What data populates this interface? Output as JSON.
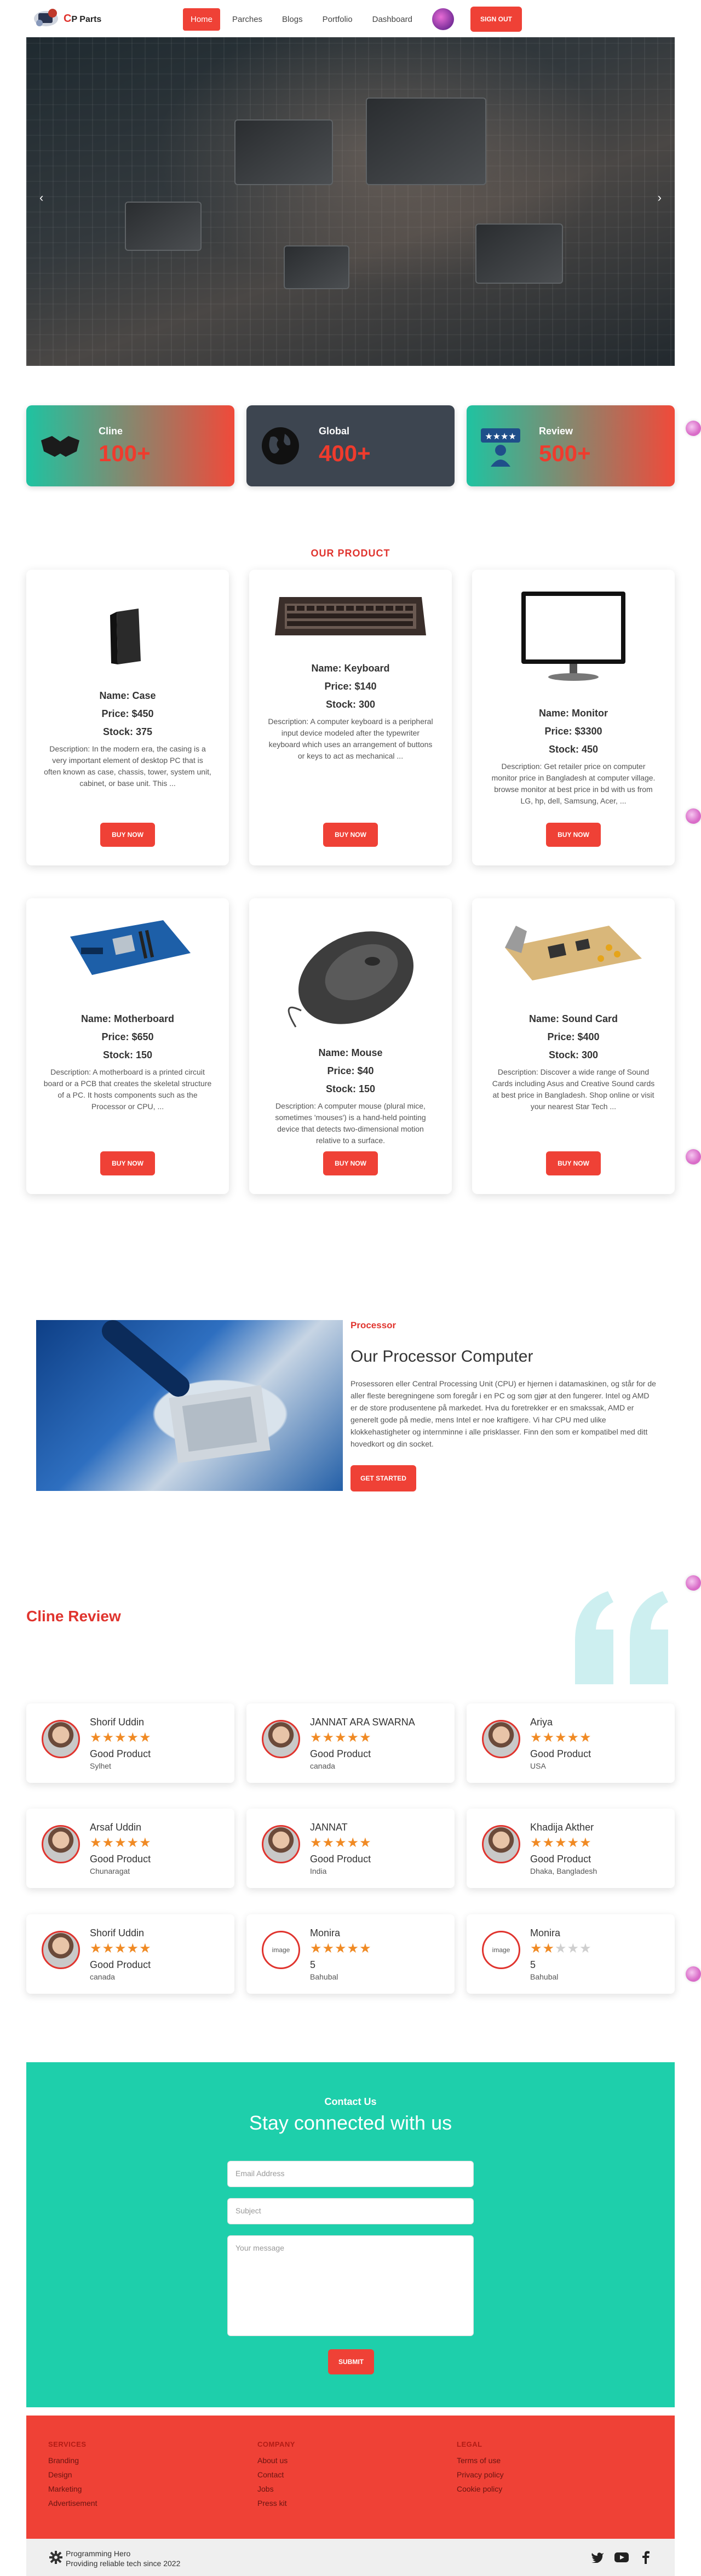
{
  "brand": {
    "initial": "C",
    "name": "P Parts"
  },
  "nav": {
    "items": [
      {
        "label": "Home",
        "active": true
      },
      {
        "label": "Parches",
        "active": false
      },
      {
        "label": "Blogs",
        "active": false
      },
      {
        "label": "Portfolio",
        "active": false
      },
      {
        "label": "Dashboard",
        "active": false
      }
    ],
    "signout_label": "SIGN OUT"
  },
  "hero": {
    "prev_icon": "chevron-left-icon",
    "next_icon": "chevron-right-icon"
  },
  "stats": [
    {
      "label": "Cline",
      "value": "100+",
      "icon": "handshake-icon"
    },
    {
      "label": "Global",
      "value": "400+",
      "icon": "globe-icon"
    },
    {
      "label": "Review",
      "value": "500+",
      "icon": "review-icon"
    }
  ],
  "products": {
    "section_title": "OUR PRODUCT",
    "items": [
      {
        "name": "Name: Case",
        "price": "Price: $450",
        "stock": "Stock: 375",
        "description": "Description: In the modern era, the casing is a very important element of desktop PC that is often known as case, chassis, tower, system unit, cabinet, or base unit. This ...",
        "button": "BUY NOW",
        "image": "pc-case"
      },
      {
        "name": "Name: Keyboard",
        "price": "Price: $140",
        "stock": "Stock: 300",
        "description": "Description: A computer keyboard is a peripheral input device modeled after the typewriter keyboard which uses an arrangement of buttons or keys to act as mechanical ...",
        "button": "BUY NOW",
        "image": "keyboard"
      },
      {
        "name": "Name: Monitor",
        "price": "Price: $3300",
        "stock": "Stock: 450",
        "description": "Description: Get retailer price on computer monitor price in Bangladesh at computer village. browse monitor at best price in bd with us from LG, hp, dell, Samsung, Acer, ...",
        "button": "BUY NOW",
        "image": "monitor"
      },
      {
        "name": "Name: Motherboard",
        "price": "Price: $650",
        "stock": "Stock: 150",
        "description": "Description: A motherboard is a printed circuit board or a PCB that creates the skeletal structure of a PC. It hosts components such as the Processor or CPU, ...",
        "button": "BUY NOW",
        "image": "motherboard"
      },
      {
        "name": "Name: Mouse",
        "price": "Price: $40",
        "stock": "Stock: 150",
        "description": "Description: A computer mouse (plural mice, sometimes 'mouses') is a hand-held pointing device that detects two-dimensional motion relative to a surface.",
        "button": "BUY NOW",
        "image": "mouse"
      },
      {
        "name": "Name: Sound Card",
        "price": "Price: $400",
        "stock": "Stock: 300",
        "description": "Description: Discover a wide range of Sound Cards including Asus and Creative Sound cards at best price in Bangladesh. Shop online or visit your nearest Star Tech ...",
        "button": "BUY NOW",
        "image": "sound-card"
      }
    ]
  },
  "processor": {
    "kicker": "Processor",
    "title": "Our Processor Computer",
    "description": "Prosessoren eller Central Processing Unit (CPU) er hjernen i datamaskinen, og står for de aller fleste beregningene som foregår i en PC og som gjør at den fungerer. Intel og AMD er de store produsentene på markedet. Hva du foretrekker er en smakssak, AMD er generelt gode på medie, mens Intel er noe kraftigere. Vi har CPU med ulike klokkehastigheter og internminne i alle prisklasser. Finn den som er kompatibel med ditt hovedkort og din socket.",
    "button": "GET STARTED"
  },
  "reviews": {
    "title": "Cline Review",
    "items": [
      {
        "name": "Shorif Uddin",
        "rating": 5,
        "text": "Good Product",
        "location": "Sylhet",
        "avatar": ""
      },
      {
        "name": "JANNAT ARA SWARNA",
        "rating": 5,
        "text": "Good Product",
        "location": "canada",
        "avatar": ""
      },
      {
        "name": "Ariya",
        "rating": 5,
        "text": "Good Product",
        "location": "USA",
        "avatar": ""
      },
      {
        "name": "Arsaf Uddin",
        "rating": 5,
        "text": "Good Product",
        "location": "Chunaragat",
        "avatar": ""
      },
      {
        "name": "JANNAT",
        "rating": 5,
        "text": "Good Product",
        "location": "India",
        "avatar": ""
      },
      {
        "name": "Khadija Akther",
        "rating": 5,
        "text": "Good Product",
        "location": "Dhaka, Bangladesh",
        "avatar": ""
      },
      {
        "name": "Shorif Uddin",
        "rating": 5,
        "text": "Good Product",
        "location": "canada",
        "avatar": ""
      },
      {
        "name": "Monira",
        "rating": 5,
        "text": "5",
        "location": "Bahubal",
        "avatar": "image"
      },
      {
        "name": "Monira",
        "rating": 2,
        "text": "5",
        "location": "Bahubal",
        "avatar": "image"
      }
    ]
  },
  "contact": {
    "kicker": "Contact Us",
    "title": "Stay connected with us",
    "email_placeholder": "Email Address",
    "subject_placeholder": "Subject",
    "message_placeholder": "Your message",
    "submit": "SUBMIT"
  },
  "footer": {
    "columns": [
      {
        "heading": "SERVICES",
        "links": [
          "Branding",
          "Design",
          "Marketing",
          "Advertisement"
        ]
      },
      {
        "heading": "COMPANY",
        "links": [
          "About us",
          "Contact",
          "Jobs",
          "Press kit"
        ]
      },
      {
        "heading": "LEGAL",
        "links": [
          "Terms of use",
          "Privacy policy",
          "Cookie policy"
        ]
      }
    ],
    "company_name": "Programming Hero",
    "tagline": "Providing reliable tech since 2022",
    "social": [
      "twitter-icon",
      "youtube-icon",
      "facebook-icon"
    ]
  },
  "colors": {
    "accent": "#ef4136",
    "teal": "#1ecfab",
    "dark_card": "#3d4550",
    "star": "#f08a24"
  }
}
